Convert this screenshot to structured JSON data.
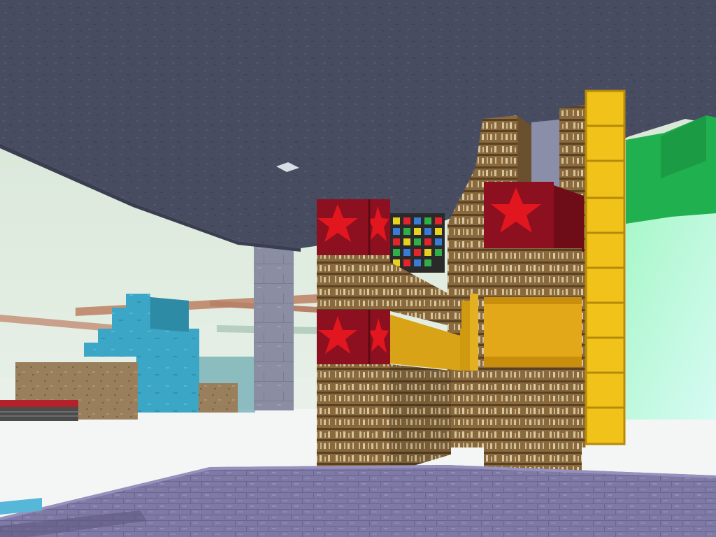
{
  "scene": {
    "kind": "first-person voxel build view",
    "colors": {
      "ceiling": "#454a5e",
      "ceiling_light": "#565b70",
      "sky_haze": "#e6f1e2",
      "floor_white": "#f2f5f3",
      "floor_purple": "#7f79a6",
      "floor_purple_light": "#9690bd",
      "stone_column": "#8b8ea3",
      "bookshelf_wood": "#8a6a3c",
      "bookshelf_dark": "#5a4124",
      "book_pages": "#cdbb98",
      "star_block": "#8d1020",
      "star_red": "#e2161e",
      "gold_block": "#f0c21a",
      "gold_block_edge": "#b7890a",
      "amber_band": "#cf9a0f",
      "lamp_grid": "#2a2a2a",
      "cyan_structure": "#3ba6c5",
      "dirt_block": "#9a7f5c",
      "green_wall": "#21b04f",
      "green_glow": "#9ff6cf",
      "copper_rail": "#c29074",
      "red_slab": "#b3212a"
    },
    "icons": [
      "star-block-icon",
      "lamp-grid-icon",
      "gold-block-icon",
      "bookshelf-icon"
    ]
  }
}
